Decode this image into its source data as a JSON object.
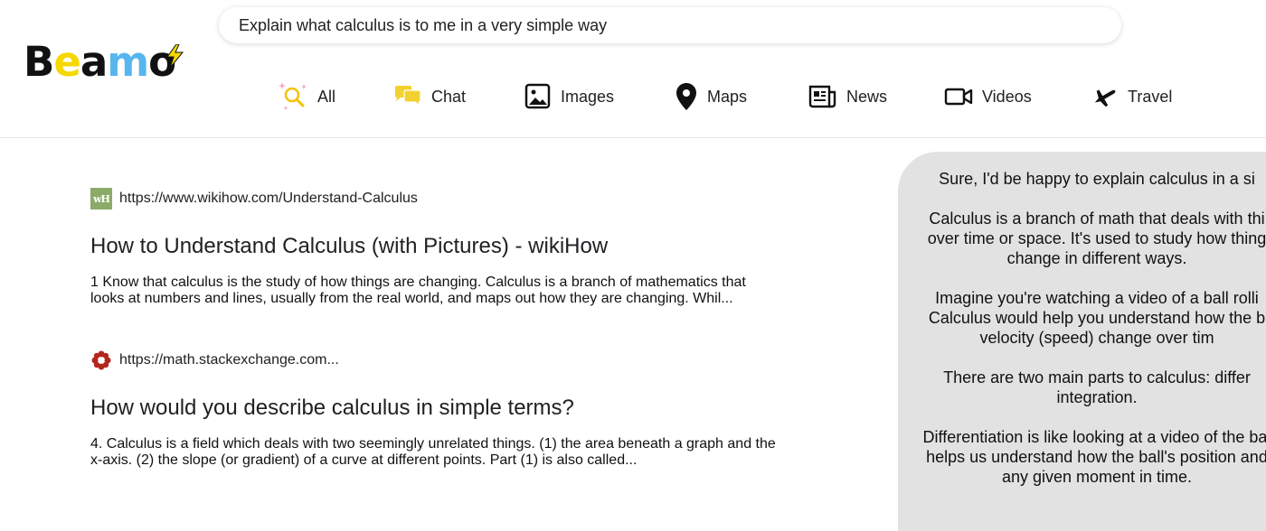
{
  "logo": {
    "letters": [
      "B",
      "e",
      "a",
      "m",
      "o"
    ],
    "colors": {
      "dark": "#111111",
      "yellow": "#f5d800",
      "blue": "#57b6ee"
    }
  },
  "search": {
    "value": "Explain what calculus is to me in a very simple way"
  },
  "nav": {
    "items": [
      {
        "label": "All",
        "icon": "sparkle-search-icon"
      },
      {
        "label": "Chat",
        "icon": "chat-bubbles-icon"
      },
      {
        "label": "Images",
        "icon": "image-icon"
      },
      {
        "label": "Maps",
        "icon": "map-pin-icon"
      },
      {
        "label": "News",
        "icon": "newspaper-icon"
      },
      {
        "label": "Videos",
        "icon": "video-camera-icon"
      },
      {
        "label": "Travel",
        "icon": "airplane-icon"
      }
    ]
  },
  "results": [
    {
      "favicon": "wH",
      "url": "https://www.wikihow.com/Understand-Calculus",
      "title": "How to Understand Calculus (with Pictures) - wikiHow",
      "snippet_lines": [
        "1 Know that calculus is the study of how things are changing. Calculus is a branch of mathematics that",
        "looks at numbers and lines, usually from the real world, and maps out how they are changing. Whil..."
      ]
    },
    {
      "favicon": "stackexchange-math-icon",
      "url": "https://math.stackexchange.com...",
      "title": "How would you describe calculus in simple terms?",
      "snippet_lines": [
        "4. Calculus is a field which deals with two seemingly unrelated things. (1) the area beneath a graph and the",
        "x-axis. (2) the slope (or gradient) of a curve at different points. Part (1) is also called..."
      ]
    }
  ],
  "chat": {
    "paragraphs": [
      [
        "Sure, I'd be happy to explain calculus in a si"
      ],
      [
        "Calculus is a branch of math that deals with thi",
        "over time or space. It's used to study how thing",
        "change in different ways."
      ],
      [
        "Imagine you're watching a video of a ball rolli",
        "Calculus would help you understand how the b",
        "velocity (speed) change over tim"
      ],
      [
        "There are two main parts to calculus: differ",
        "integration."
      ],
      [
        "Differentiation is like looking at a video of the bal",
        "helps us understand how the ball's position and",
        "any given moment in time."
      ]
    ]
  }
}
